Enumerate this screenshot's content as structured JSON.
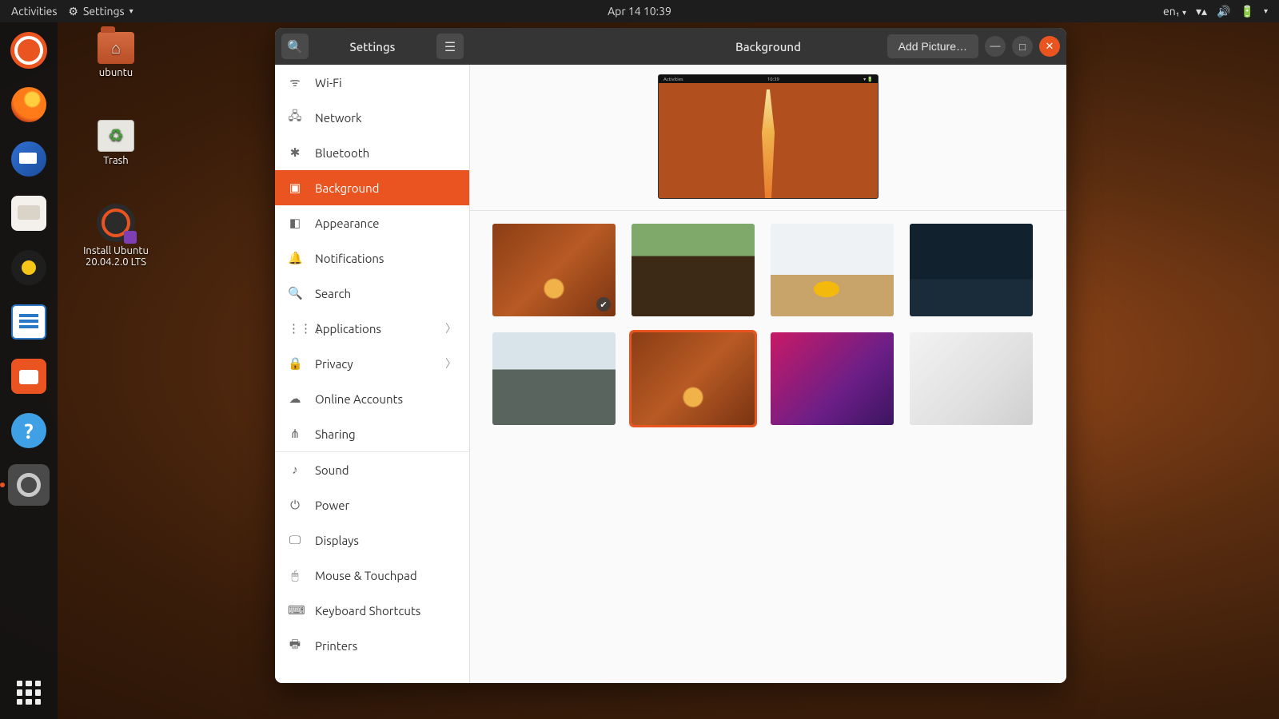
{
  "panel": {
    "activities": "Activities",
    "appmenu": "Settings",
    "clock": "Apr 14  10:39",
    "lang": "en₁"
  },
  "desktop": {
    "home": "ubuntu",
    "trash": "Trash",
    "install": "Install Ubuntu\n20.04.2.0 LTS"
  },
  "window": {
    "left_title": "Settings",
    "right_title": "Background",
    "add_picture": "Add Picture…"
  },
  "sidebar": [
    {
      "icon": "wifi",
      "label": "Wi-Fi"
    },
    {
      "icon": "net",
      "label": "Network"
    },
    {
      "icon": "bt",
      "label": "Bluetooth"
    },
    {
      "icon": "bg",
      "label": "Background",
      "selected": true
    },
    {
      "icon": "app",
      "label": "Appearance"
    },
    {
      "icon": "notif",
      "label": "Notifications"
    },
    {
      "icon": "search",
      "label": "Search"
    },
    {
      "icon": "apps",
      "label": "Applications",
      "chev": true
    },
    {
      "icon": "priv",
      "label": "Privacy",
      "chev": true
    },
    {
      "icon": "cloud",
      "label": "Online Accounts"
    },
    {
      "icon": "share",
      "label": "Sharing",
      "divider_after": true
    },
    {
      "icon": "sound",
      "label": "Sound"
    },
    {
      "icon": "power",
      "label": "Power"
    },
    {
      "icon": "disp",
      "label": "Displays"
    },
    {
      "icon": "mouse",
      "label": "Mouse & Touchpad"
    },
    {
      "icon": "kbd",
      "label": "Keyboard Shortcuts"
    },
    {
      "icon": "print",
      "label": "Printers"
    }
  ],
  "preview_bar": {
    "left": "Activities",
    "center": "10:39"
  },
  "thumbs": [
    {
      "cls": "t-focal",
      "badge": true
    },
    {
      "cls": "t-forest"
    },
    {
      "cls": "t-desk"
    },
    {
      "cls": "t-corr"
    },
    {
      "cls": "t-bridge"
    },
    {
      "cls": "t-focal",
      "selected": true
    },
    {
      "cls": "t-cat-p"
    },
    {
      "cls": "t-cat-g"
    }
  ],
  "sidebar_icons": {
    "wifi": "ᯤ",
    "net": "🖧",
    "bt": "✱",
    "bg": "▣",
    "app": "◧",
    "notif": "🔔",
    "search": "🔍",
    "apps": "⋮⋮⋮",
    "priv": "🔒",
    "cloud": "☁",
    "share": "⋔",
    "sound": "♪",
    "power": "⏻",
    "disp": "🖵",
    "mouse": "🖱",
    "kbd": "⌨",
    "print": "🖶"
  }
}
